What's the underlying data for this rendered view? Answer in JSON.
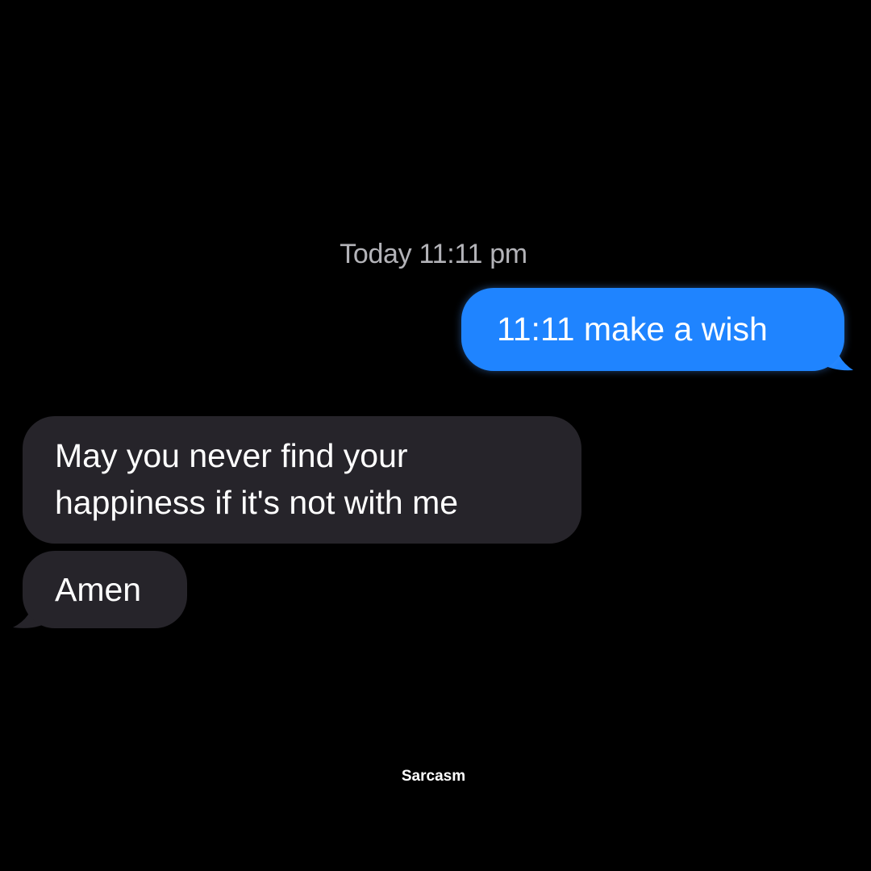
{
  "conversation": {
    "timestamp": "Today 11:11 pm",
    "messages": [
      {
        "direction": "sent",
        "text": "11:11 make a wish"
      },
      {
        "direction": "received",
        "text_lines": [
          "May you never find your",
          "happiness if it's not with me"
        ]
      },
      {
        "direction": "received",
        "text": "Amen"
      }
    ]
  },
  "watermark": "Sarcasm",
  "colors": {
    "background": "#000000",
    "sent_bubble": "#1f84ff",
    "received_bubble": "#26242a",
    "timestamp_text": "#b3b3b8",
    "message_text": "#ffffff"
  }
}
